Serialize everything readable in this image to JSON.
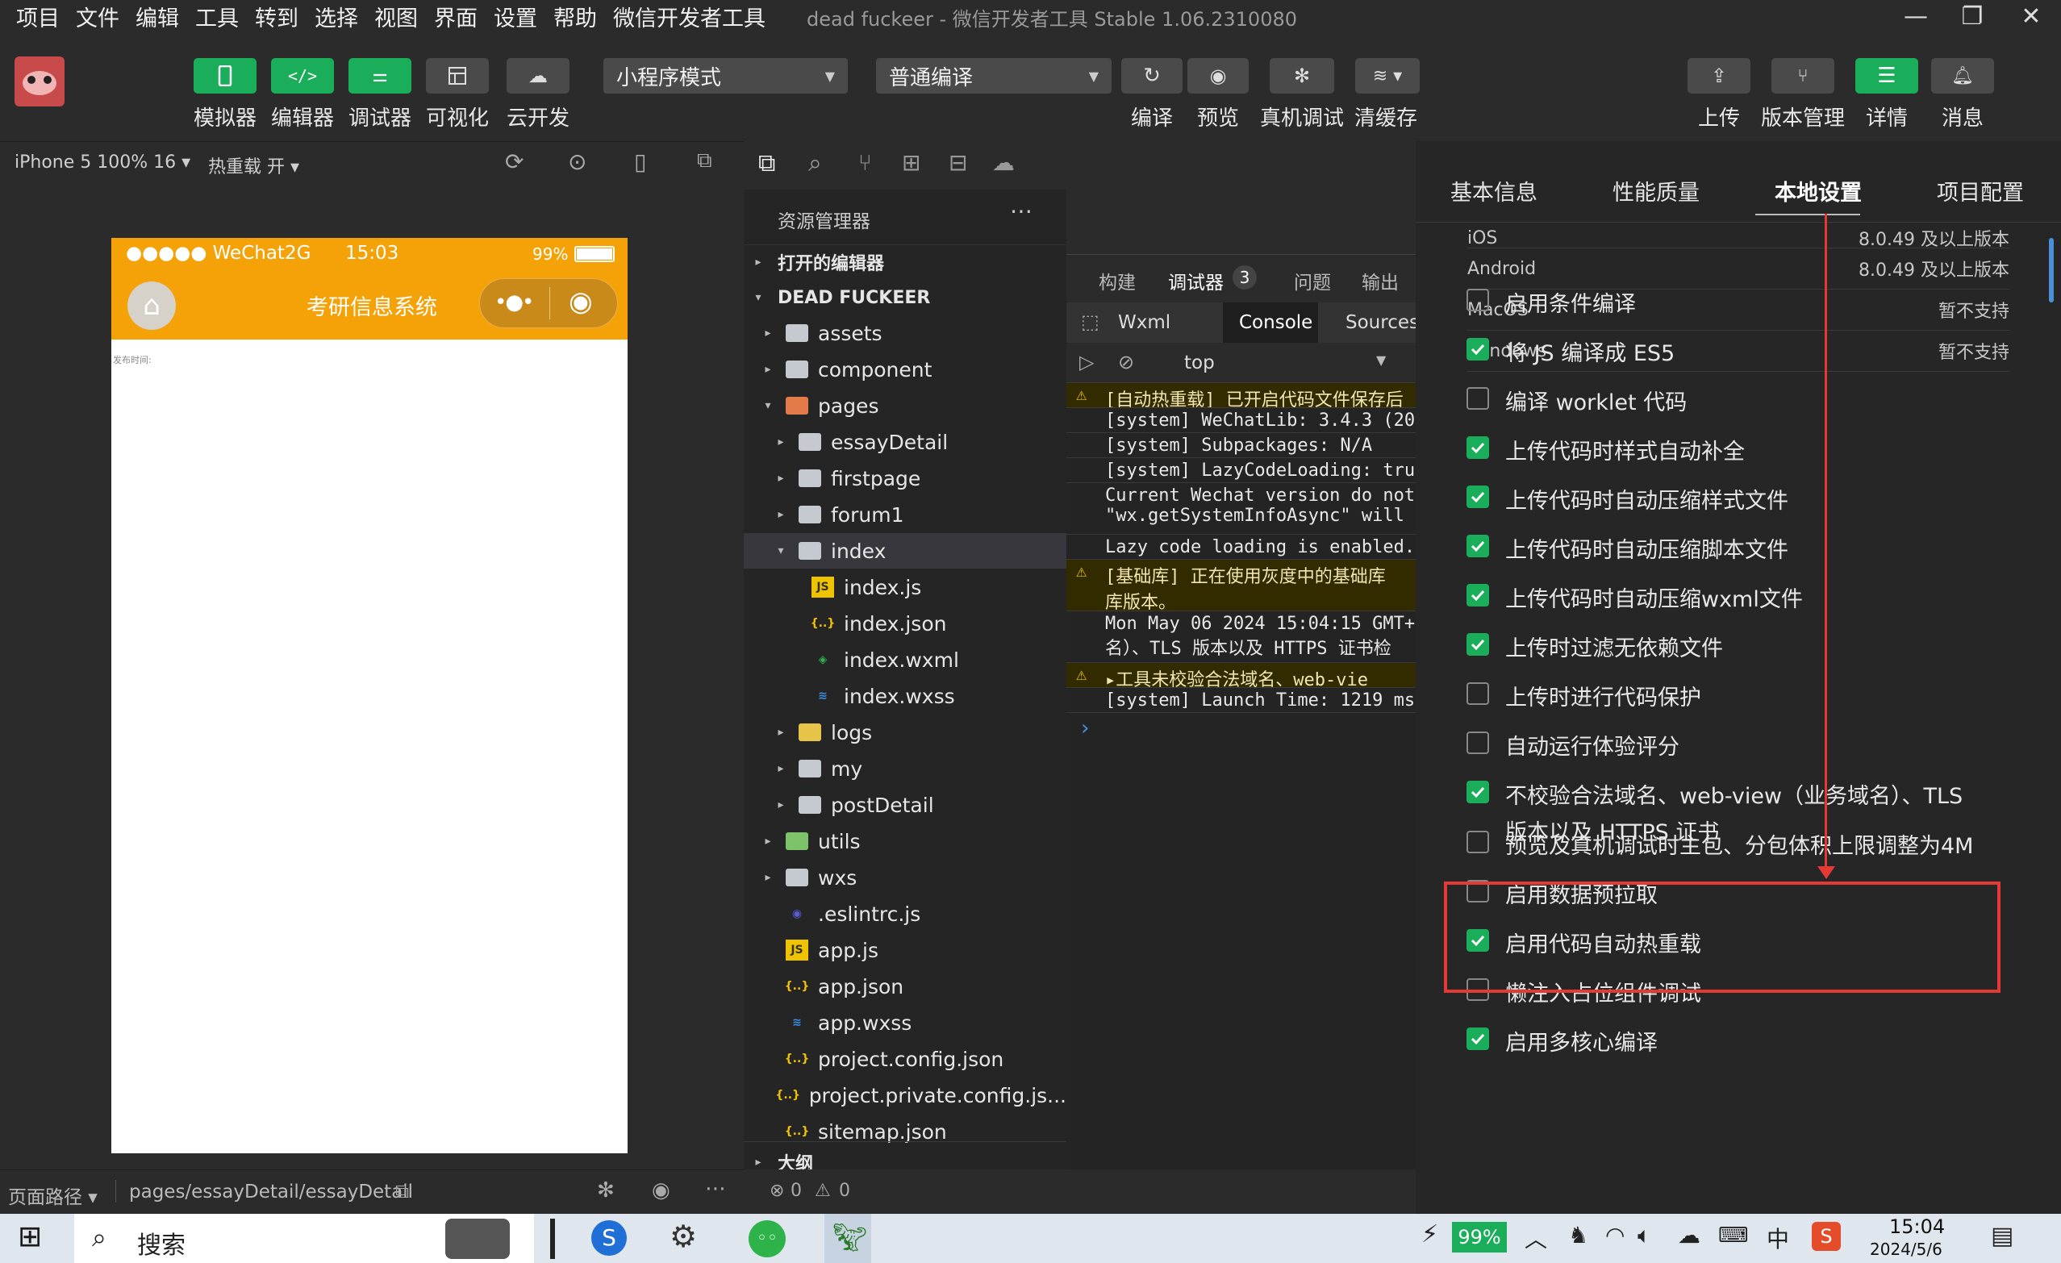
{
  "menu": [
    "项目",
    "文件",
    "编辑",
    "工具",
    "转到",
    "选择",
    "视图",
    "界面",
    "设置",
    "帮助",
    "微信开发者工具"
  ],
  "window_title": "dead fuckeer - 微信开发者工具 Stable 1.06.2310080",
  "toolbar": {
    "simulator": "模拟器",
    "editor": "编辑器",
    "debugger": "调试器",
    "visual": "可视化",
    "cloud": "云开发",
    "mode_select": "小程序模式",
    "compile_select": "普通编译",
    "compile": "编译",
    "preview": "预览",
    "real_debug": "真机调试",
    "clear_cache": "清缓存",
    "upload": "上传",
    "version": "版本管理",
    "details": "详情",
    "messages": "消息"
  },
  "simulator": {
    "device": "iPhone 5 100% 16",
    "hot_reload": "热重载 开",
    "carrier": "●●●●● WeChat2G",
    "time": "15:03",
    "battery": "99%",
    "nav_title": "考研信息系统",
    "content_text": "发布时间:",
    "path_label": "页面路径",
    "path": "pages/essayDetail/essayDetail"
  },
  "explorer": {
    "title": "资源管理器",
    "open_editors": "打开的编辑器",
    "project": "DEAD FUCKEER",
    "items": [
      {
        "label": "assets",
        "kind": "folder",
        "depth": 1,
        "chev": "▸"
      },
      {
        "label": "component",
        "kind": "folder",
        "depth": 1,
        "chev": "▸"
      },
      {
        "label": "pages",
        "kind": "folder-red",
        "depth": 1,
        "chev": "▾"
      },
      {
        "label": "essayDetail",
        "kind": "folder",
        "depth": 2,
        "chev": "▸"
      },
      {
        "label": "firstpage",
        "kind": "folder",
        "depth": 2,
        "chev": "▸"
      },
      {
        "label": "forum1",
        "kind": "folder",
        "depth": 2,
        "chev": "▸"
      },
      {
        "label": "index",
        "kind": "folder-open",
        "depth": 2,
        "chev": "▾"
      },
      {
        "label": "index.js",
        "kind": "js",
        "depth": 3,
        "chev": ""
      },
      {
        "label": "index.json",
        "kind": "json",
        "depth": 3,
        "chev": ""
      },
      {
        "label": "index.wxml",
        "kind": "wxml",
        "depth": 3,
        "chev": ""
      },
      {
        "label": "index.wxss",
        "kind": "wxss",
        "depth": 3,
        "chev": ""
      },
      {
        "label": "logs",
        "kind": "folder-y",
        "depth": 2,
        "chev": "▸"
      },
      {
        "label": "my",
        "kind": "folder",
        "depth": 2,
        "chev": "▸"
      },
      {
        "label": "postDetail",
        "kind": "folder",
        "depth": 2,
        "chev": "▸"
      },
      {
        "label": "utils",
        "kind": "folder-g",
        "depth": 1,
        "chev": "▸"
      },
      {
        "label": "wxs",
        "kind": "folder",
        "depth": 1,
        "chev": "▸"
      },
      {
        "label": ".eslintrc.js",
        "kind": "eslint",
        "depth": 1,
        "chev": ""
      },
      {
        "label": "app.js",
        "kind": "js",
        "depth": 1,
        "chev": ""
      },
      {
        "label": "app.json",
        "kind": "json",
        "depth": 1,
        "chev": ""
      },
      {
        "label": "app.wxss",
        "kind": "wxss",
        "depth": 1,
        "chev": ""
      },
      {
        "label": "project.config.json",
        "kind": "json",
        "depth": 1,
        "chev": ""
      },
      {
        "label": "project.private.config.js...",
        "kind": "json",
        "depth": 1,
        "chev": ""
      },
      {
        "label": "sitemap.json",
        "kind": "json",
        "depth": 1,
        "chev": ""
      }
    ],
    "outline": "大纲",
    "errors": "0",
    "warnings": "0"
  },
  "devtools": {
    "tabs": [
      "构建",
      "调试器",
      "问题",
      "输出"
    ],
    "debug_count": "3",
    "subtabs": [
      "Wxml",
      "Console",
      "Sources"
    ],
    "context": "top",
    "lines": [
      {
        "text": "[自动热重载] 已开启代码文件保存后",
        "warn": true
      },
      {
        "text": "[system] WeChatLib: 3.4.3 (20",
        "warn": false
      },
      {
        "text": "[system] Subpackages: N/A",
        "warn": false
      },
      {
        "text": "[system] LazyCodeLoading: tru",
        "warn": false
      },
      {
        "text": "Current Wechat version do not",
        "text2": "\"wx.getSystemInfoAsync\" will",
        "warn": false
      },
      {
        "text": "Lazy code loading is enabled.",
        "warn": false
      },
      {
        "text": "[基础库] 正在使用灰度中的基础库",
        "text2": "库版本。",
        "warn": true
      },
      {
        "text": "Mon May 06 2024 15:04:15 GMT+",
        "text2": "名）、TLS 版本以及 HTTPS 证书检",
        "warn": false
      },
      {
        "text": "▸工具未校验合法域名、web-vie",
        "warn": true
      },
      {
        "text": "[system] Launch Time: 1219 ms",
        "warn": false
      }
    ]
  },
  "settings": {
    "tabs": [
      "基本信息",
      "性能质量",
      "本地设置",
      "项目配置"
    ],
    "platforms": [
      {
        "name": "iOS",
        "value": "8.0.49 及以上版本"
      },
      {
        "name": "Android",
        "value": "8.0.49 及以上版本"
      },
      {
        "name": "MacOS",
        "value": "暂不支持"
      },
      {
        "name": "Windows",
        "value": "暂不支持"
      }
    ],
    "options": [
      {
        "label": "启用条件编译",
        "checked": false
      },
      {
        "label": "将 JS 编译成 ES5",
        "checked": true
      },
      {
        "label": "编译 worklet 代码",
        "checked": false
      },
      {
        "label": "上传代码时样式自动补全",
        "checked": true
      },
      {
        "label": "上传代码时自动压缩样式文件",
        "checked": true
      },
      {
        "label": "上传代码时自动压缩脚本文件",
        "checked": true
      },
      {
        "label": "上传代码时自动压缩wxml文件",
        "checked": true
      },
      {
        "label": "上传时过滤无依赖文件",
        "checked": true
      },
      {
        "label": "上传时进行代码保护",
        "checked": false
      },
      {
        "label": "自动运行体验评分",
        "checked": false
      },
      {
        "label": "不校验合法域名、web-view（业务域名）、TLS",
        "label2": "版本以及 HTTPS 证书",
        "checked": true
      },
      {
        "label": "预览及真机调试时主包、分包体积上限调整为4M",
        "checked": false
      },
      {
        "label": "启用数据预拉取",
        "checked": false
      },
      {
        "label": "启用代码自动热重载",
        "checked": true
      },
      {
        "label": "懒注入占位组件调试",
        "checked": false
      },
      {
        "label": "启用多核心编译",
        "checked": true
      }
    ],
    "highlight_color": "#e53935"
  },
  "taskbar": {
    "search": "搜索",
    "battery": "99%",
    "time": "15:04",
    "date": "2024/5/6"
  },
  "colors": {
    "accent": "#1aad5a",
    "phone_header": "#f5a209",
    "highlight": "#e53935"
  }
}
